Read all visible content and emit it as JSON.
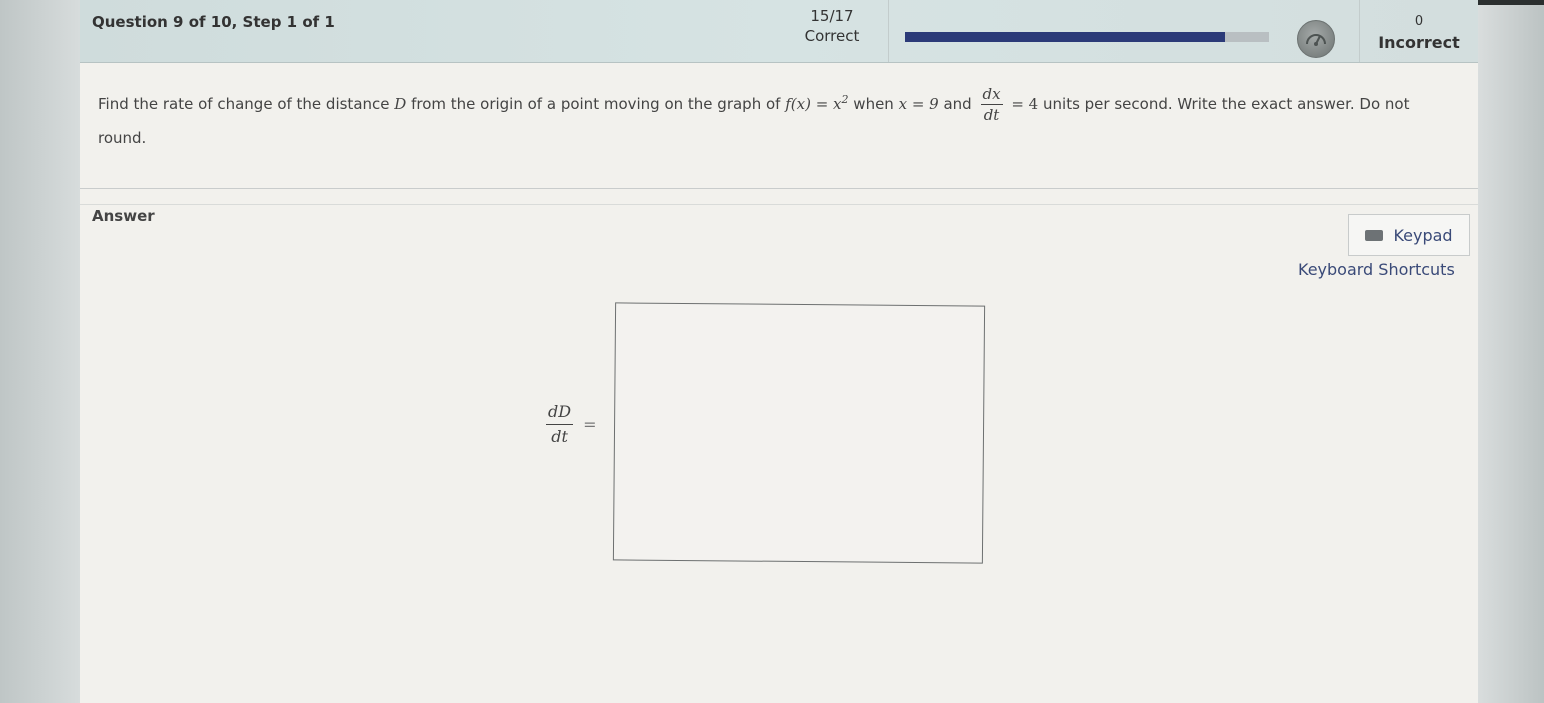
{
  "header": {
    "question_label": "Question 9 of 10, Step 1 of 1",
    "correct_count": "15/17",
    "correct_label": "Correct",
    "progress_fraction": 0.88,
    "incorrect_count": "0",
    "incorrect_label": "Incorrect"
  },
  "question": {
    "text_1": "Find the rate of change of the distance",
    "var_D": "D",
    "text_2": "from the origin of a point moving on the graph of",
    "func": "f(x) = x",
    "func_exp": "2",
    "text_3": "when",
    "cond": "x = 9",
    "text_4": "and",
    "frac_num": "dx",
    "frac_den": "dt",
    "eq_val": "= 4",
    "text_5": "units per second. Write the exact answer. Do not round."
  },
  "answer": {
    "label": "Answer",
    "keypad_label": "Keypad",
    "shortcuts_label": "Keyboard Shortcuts",
    "lhs_num": "dD",
    "lhs_den": "dt",
    "equals": "="
  },
  "icons": {
    "gauge": "gauge-icon",
    "keyboard": "keyboard-icon"
  }
}
